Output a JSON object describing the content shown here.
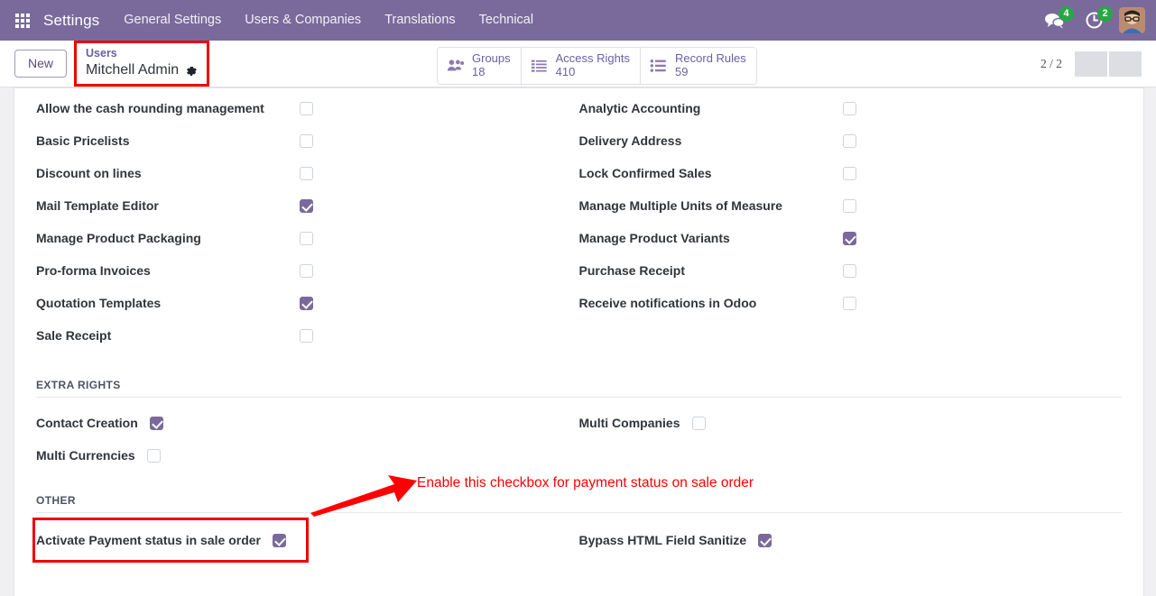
{
  "navbar": {
    "apps_icon": "apps-grid-icon",
    "brand": "Settings",
    "menus": [
      {
        "label": "General Settings"
      },
      {
        "label": "Users & Companies"
      },
      {
        "label": "Translations"
      },
      {
        "label": "Technical"
      }
    ],
    "messages_icon": "chat-bubble-icon",
    "messages_count": "4",
    "activities_icon": "clock-icon",
    "activities_count": "2",
    "avatar_icon": "user-avatar"
  },
  "control_panel": {
    "new_button": "New",
    "breadcrumb_parent": "Users",
    "breadcrumb_current": "Mitchell Admin",
    "settings_gear_icon": "gear-icon",
    "stat_buttons": [
      {
        "icon": "users-icon",
        "label": "Groups",
        "value": "18"
      },
      {
        "icon": "list-icon",
        "label": "Access Rights",
        "value": "410"
      },
      {
        "icon": "list-dot-icon",
        "label": "Record Rules",
        "value": "59"
      }
    ],
    "pager": "2 / 2",
    "prev_icon": "chevron-left-icon",
    "next_icon": "chevron-right-icon"
  },
  "rights": {
    "left": [
      {
        "label": "Allow the cash rounding management",
        "checked": false
      },
      {
        "label": "Basic Pricelists",
        "checked": false
      },
      {
        "label": "Discount on lines",
        "checked": false
      },
      {
        "label": "Mail Template Editor",
        "checked": true
      },
      {
        "label": "Manage Product Packaging",
        "checked": false
      },
      {
        "label": "Pro-forma Invoices",
        "checked": false
      },
      {
        "label": "Quotation Templates",
        "checked": true
      },
      {
        "label": "Sale Receipt",
        "checked": false
      }
    ],
    "right": [
      {
        "label": "Analytic Accounting",
        "checked": false
      },
      {
        "label": "Delivery Address",
        "checked": false
      },
      {
        "label": "Lock Confirmed Sales",
        "checked": false
      },
      {
        "label": "Manage Multiple Units of Measure",
        "checked": false
      },
      {
        "label": "Manage Product Variants",
        "checked": true
      },
      {
        "label": "Purchase Receipt",
        "checked": false
      },
      {
        "label": "Receive notifications in Odoo",
        "checked": false
      }
    ]
  },
  "extra_rights": {
    "title": "EXTRA RIGHTS",
    "left": [
      {
        "label": "Contact Creation",
        "checked": true
      },
      {
        "label": "Multi Currencies",
        "checked": false
      }
    ],
    "right": [
      {
        "label": "Multi Companies",
        "checked": false
      }
    ]
  },
  "other": {
    "title": "OTHER",
    "left": [
      {
        "label": "Activate Payment status in sale order",
        "checked": true
      }
    ],
    "right": [
      {
        "label": "Bypass HTML Field Sanitize",
        "checked": true
      }
    ]
  },
  "annotation": {
    "text": "Enable this checkbox for payment status on sale order",
    "arrow_icon": "red-arrow-icon",
    "color": "#ff0000",
    "highlight_color": "#ee0000"
  }
}
